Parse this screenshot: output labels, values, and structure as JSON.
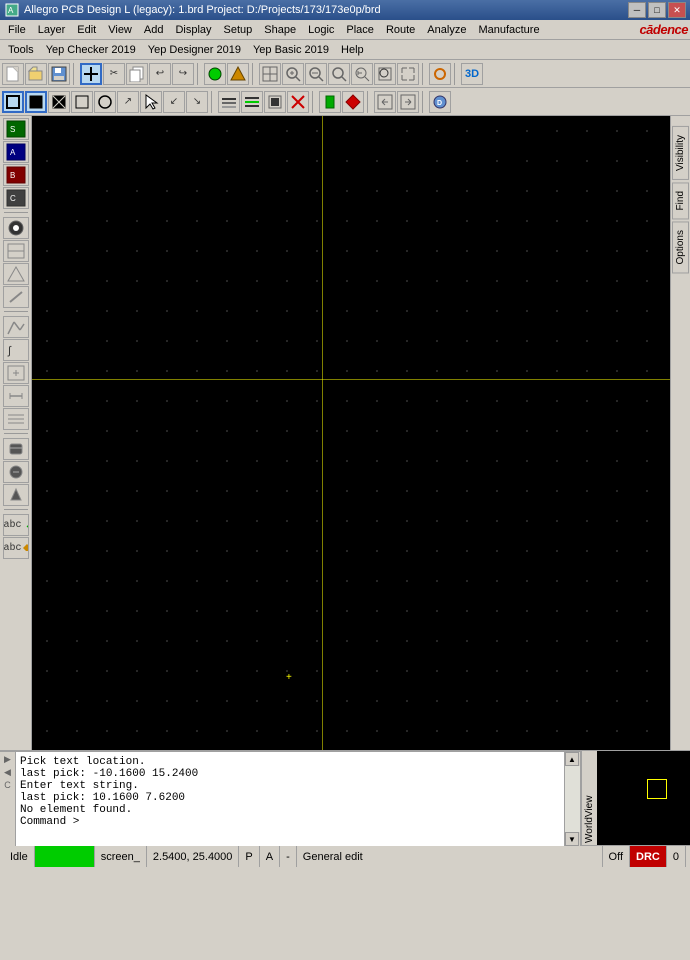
{
  "window": {
    "title": "Allegro PCB Design L (legacy): 1.brd  Project: D:/Projects/173/173e0p/brd",
    "icon": "⬛"
  },
  "menu": {
    "items": [
      "File",
      "Layer",
      "Edit",
      "View",
      "Add",
      "Display",
      "Setup",
      "Shape",
      "Logic",
      "Place",
      "Route",
      "Analyze",
      "Manufacture"
    ],
    "secondary": [
      "Tools",
      "Yep Checker 2019",
      "Yep Designer 2019",
      "Yep Basic 2019",
      "Help"
    ]
  },
  "cadence_logo": "cādence",
  "toolbar1": {
    "buttons": [
      "📂",
      "💾",
      "📄",
      "✂",
      "📋",
      "↩",
      "↪",
      "⬛",
      "📌",
      "📌",
      "🔲",
      "📋",
      "🔍",
      "🔍",
      "🔍",
      "🔍",
      "🔍",
      "🔍",
      "🔍",
      "🔍"
    ]
  },
  "toolbar2": {
    "buttons": [
      "□",
      "■",
      "◼",
      "◻",
      "○",
      "↗",
      "↙",
      "↖",
      "↘",
      "◻",
      "◼",
      "◻",
      "◼",
      "⬛",
      "🔧",
      "📍",
      "◀",
      "▶",
      "💠"
    ]
  },
  "left_toolbar": {
    "sections": [
      {
        "buttons": [
          "⬛",
          "⬛",
          "⬛",
          "⬛",
          "⬛"
        ]
      },
      {
        "buttons": [
          "⬛",
          "⬛",
          "⬛",
          "⬛"
        ]
      },
      {
        "buttons": [
          "⬛",
          "⬛",
          "⬛",
          "⬛",
          "⬛"
        ]
      },
      {
        "buttons": [
          "⬛",
          "⬛",
          "⬛"
        ]
      },
      {
        "buttons": [
          "abc",
          "abc"
        ]
      }
    ]
  },
  "right_panel": {
    "tabs": [
      "Visibility",
      "Find",
      "Options"
    ]
  },
  "console": {
    "lines": [
      "Pick text location.",
      "last pick:  -10.1600 15.2400",
      "Enter text string.",
      "last pick:  10.1600 7.6200",
      "No element found.",
      "Command >"
    ]
  },
  "worldview": {
    "label": "WorldView"
  },
  "status_bar": {
    "idle": "Idle",
    "command_indicator": "",
    "coordinate_label": "screen_",
    "coordinates": "2.5400, 25.4000",
    "p_label": "P",
    "a_label": "A",
    "dash": "-",
    "general_edit": "General edit",
    "off": "Off",
    "drc": "DRC",
    "count": "0"
  }
}
